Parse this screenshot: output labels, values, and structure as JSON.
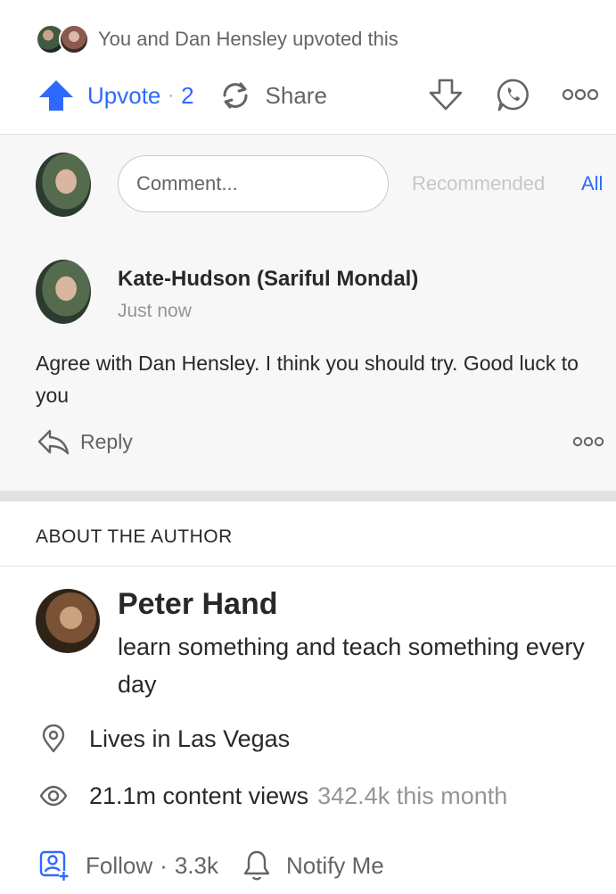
{
  "upvoters": {
    "text": "You and Dan Hensley upvoted this"
  },
  "actions": {
    "upvote_label": "Upvote",
    "separator": "·",
    "upvote_count": "2",
    "share_label": "Share"
  },
  "comment_box": {
    "placeholder": "Comment...",
    "tab_recommended": "Recommended",
    "tab_all": "All"
  },
  "comment": {
    "author": "Kate-Hudson (Sariful Mondal)",
    "time": "Just now",
    "text": "Agree with Dan Hensley. I think you should try. Good luck to you",
    "reply_label": "Reply"
  },
  "about": {
    "heading": "ABOUT THE AUTHOR",
    "name": "Peter Hand",
    "bio": "learn something and teach something every day",
    "location": "Lives in Las Vegas",
    "views": "21.1m content views",
    "views_month": "342.4k this month",
    "follow_label": "Follow",
    "separator": "·",
    "follow_count": "3.3k",
    "notify_label": "Notify Me"
  },
  "colors": {
    "accent": "#2e69ff",
    "secondary_text": "#636466",
    "muted_text": "#939598",
    "band_background": "#f7f7f8"
  }
}
